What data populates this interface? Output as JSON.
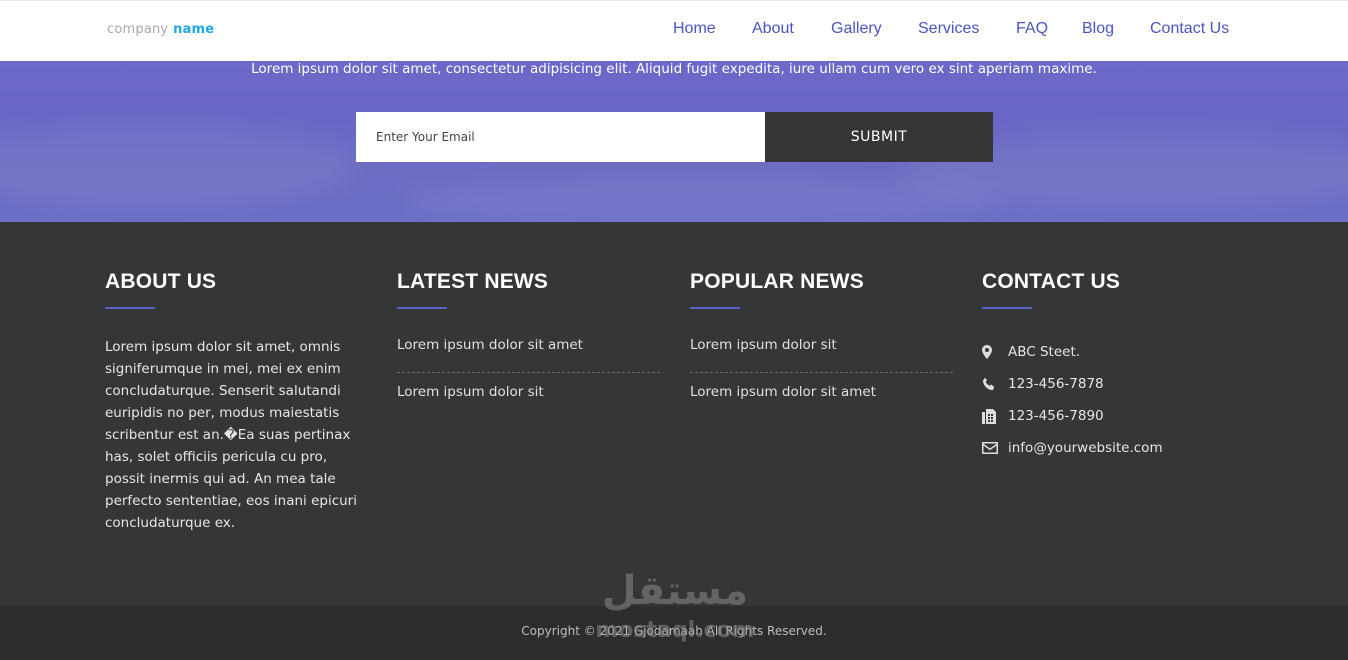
{
  "header": {
    "logo_part1": "company",
    "logo_part2": "name",
    "nav": [
      "Home",
      "About",
      "Gallery",
      "Services",
      "FAQ",
      "Blog",
      "Contact Us"
    ]
  },
  "hero": {
    "text": "Lorem ipsum dolor sit amet, consectetur adipisicing elit. Aliquid fugit expedita, iure ullam cum vero ex sint aperiam maxime.",
    "email_placeholder": "Enter Your Email",
    "submit_label": "SUBMIT"
  },
  "footer": {
    "about": {
      "title": "ABOUT US",
      "text": "Lorem ipsum dolor sit amet, omnis signiferumque in mei, mei ex enim concludaturque. Senserit salutandi euripidis no per, modus maiestatis scribentur est an.�Ea suas pertinax has, solet officiis pericula cu pro, possit inermis qui ad. An mea tale perfecto sententiae, eos inani epicuri concludaturque ex."
    },
    "latest_news": {
      "title": "LATEST NEWS",
      "items": [
        "Lorem ipsum dolor sit amet",
        "Lorem ipsum dolor sit"
      ]
    },
    "popular_news": {
      "title": "POPULAR NEWS",
      "items": [
        "Lorem ipsum dolor sit",
        "Lorem ipsum dolor sit amet"
      ]
    },
    "contact": {
      "title": "CONTACT US",
      "address": "ABC Steet.",
      "phone": "123-456-7878",
      "fax": "123-456-7890",
      "email": "info@yourwebsite.com"
    }
  },
  "copyright": "Copyright © 2021 Gjodamaah All Rights Reserved.",
  "watermark": {
    "arabic": "مستقل",
    "latin": "mostaql.com"
  },
  "colors": {
    "nav_link": "#4a55c2",
    "logo_accent": "#1ea7e4",
    "hero_bg": "#6b6ac6",
    "footer_bg": "#353637",
    "underline_accent": "#5a62c9"
  }
}
